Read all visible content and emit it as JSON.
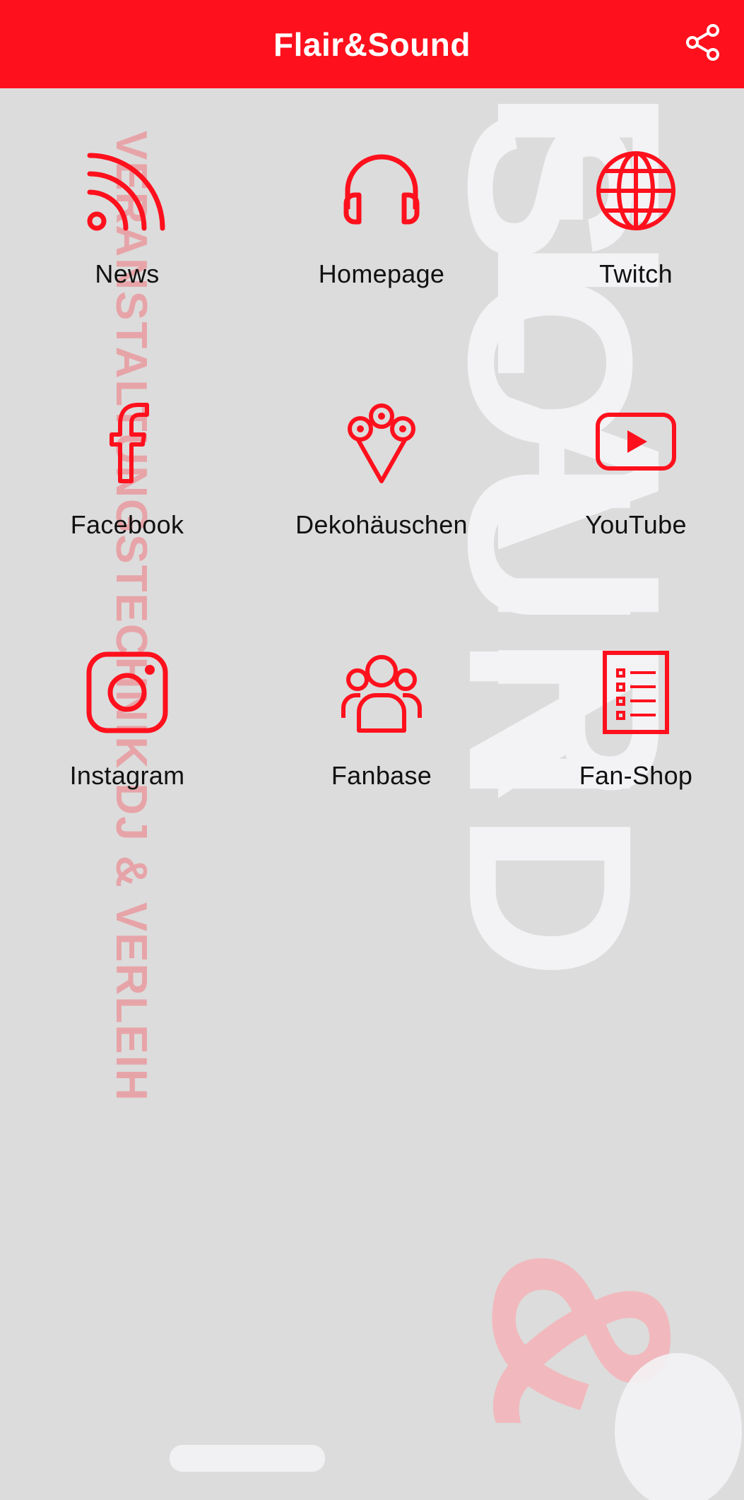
{
  "app": {
    "title": "Flair&Sound",
    "accent_color": "#fe101d"
  },
  "toolbar": {
    "share_icon": "share-icon"
  },
  "background": {
    "logo_text": [
      "FLAIR",
      "SOUND",
      "&"
    ],
    "tagline": "VERANSTALTUNGSTECHNIK DJ & VERLEIH"
  },
  "tiles": [
    {
      "label": "News",
      "icon": "rss-icon"
    },
    {
      "label": "Homepage",
      "icon": "headphones-icon"
    },
    {
      "label": "Twitch",
      "icon": "globe-icon"
    },
    {
      "label": "Facebook",
      "icon": "facebook-icon"
    },
    {
      "label": "Dekohäuschen",
      "icon": "bouquet-icon"
    },
    {
      "label": "YouTube",
      "icon": "youtube-icon"
    },
    {
      "label": "Instagram",
      "icon": "instagram-icon"
    },
    {
      "label": "Fanbase",
      "icon": "group-icon"
    },
    {
      "label": "Fan-Shop",
      "icon": "list-icon"
    }
  ]
}
